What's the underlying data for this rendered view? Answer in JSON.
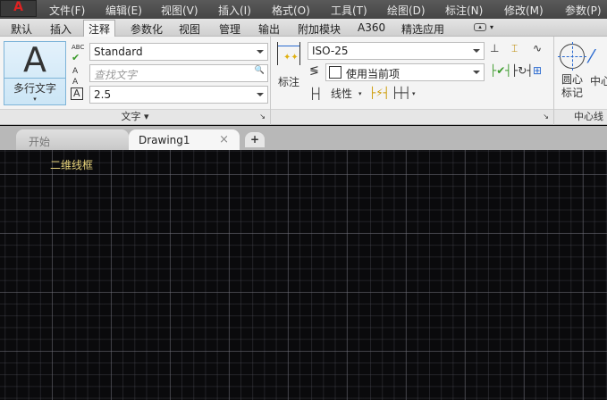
{
  "app": {
    "logo": "A"
  },
  "menubar": [
    "文件(F)",
    "编辑(E)",
    "视图(V)",
    "插入(I)",
    "格式(O)",
    "工具(T)",
    "绘图(D)",
    "标注(N)",
    "修改(M)",
    "参数(P)"
  ],
  "ribbon_tabs": [
    "默认",
    "插入",
    "注释",
    "参数化",
    "视图",
    "管理",
    "输出",
    "附加模块",
    "A360",
    "精选应用"
  ],
  "active_tab": "注释",
  "text_panel": {
    "big_button": "多行文字",
    "big_icon": "A",
    "style": "Standard",
    "find_placeholder": "查找文字",
    "height": "2.5",
    "title": "文字 ▾",
    "check_icon_text": "ABC"
  },
  "dim_panel": {
    "big_button": "标注",
    "style": "ISO-25",
    "layer": "使用当前项",
    "linear": "线性"
  },
  "center_panel": {
    "btn1_line1": "圆心",
    "btn1_line2": "标记",
    "btn2": "中心",
    "title": "中心线"
  },
  "file_tabs": {
    "start": "开始",
    "drawing": "Drawing1",
    "close": "×",
    "add": "+"
  },
  "viewport": {
    "label": "二维线框"
  }
}
